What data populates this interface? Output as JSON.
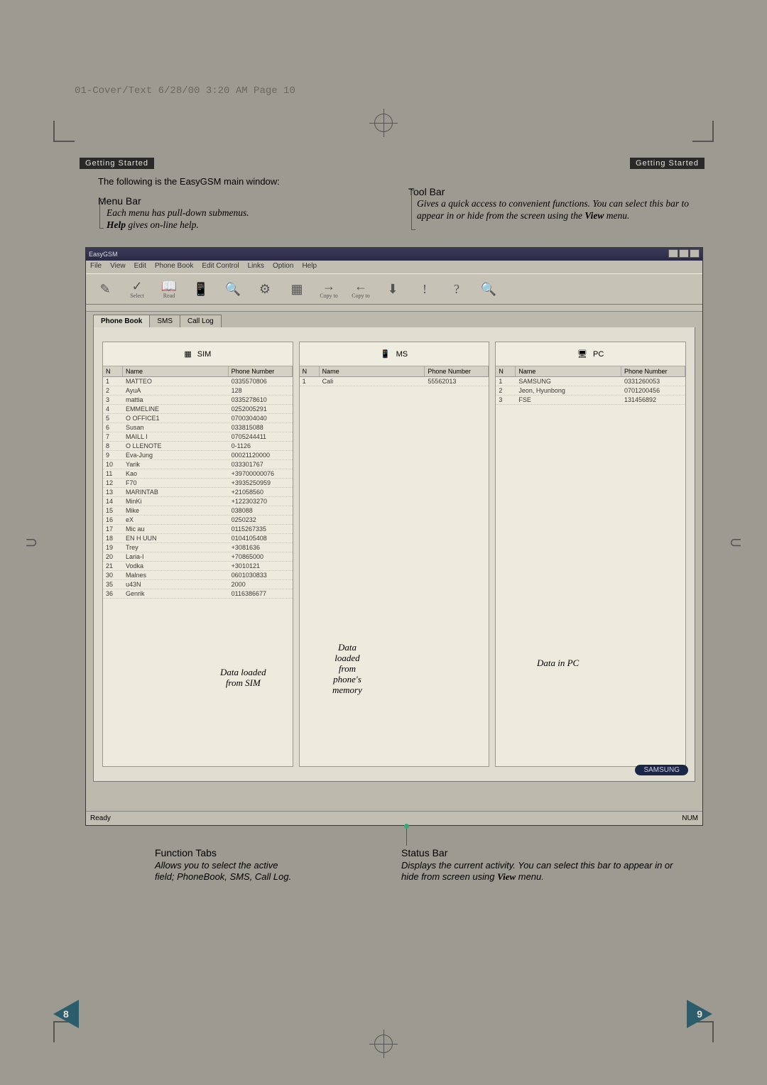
{
  "print_header": "01-Cover/Text  6/28/00  3:20 AM  Page 10",
  "section_label": "Getting Started",
  "intro": "The following is the EasyGSM main window:",
  "menu_bar": {
    "heading": "Menu Bar",
    "line1": "Each menu has pull-down submenus.",
    "line2_bold": "Help",
    "line2_rest": " gives on-line help."
  },
  "tool_bar": {
    "heading": "Tool Bar",
    "text_a": "Gives a quick access to convenient functions. You can select this bar to appear in or hide from the screen using the ",
    "view": "View",
    "text_b": " menu."
  },
  "function_tabs": {
    "heading": "Function Tabs",
    "line1": "Allows you to select the active",
    "line2": "field; PhoneBook, SMS, Call Log."
  },
  "status_bar": {
    "heading": "Status Bar",
    "text_a": "Displays the current activity. You can select this bar to appear in or hide from screen using ",
    "view": "View",
    "text_b": " menu."
  },
  "pages": {
    "left": "8",
    "right": "9"
  },
  "app": {
    "title": "EasyGSM",
    "menus": [
      "File",
      "View",
      "Edit",
      "Phone Book",
      "Edit Control",
      "Links",
      "Option",
      "Help"
    ],
    "toolbar_hints": [
      "",
      "Select",
      "Read",
      "",
      "",
      "",
      "",
      "Copy to",
      "Copy to",
      "",
      "",
      "",
      ""
    ],
    "tabs": [
      "Phone Book",
      "SMS",
      "Call Log"
    ],
    "col_headers": [
      "N",
      "Name",
      "Phone Number"
    ],
    "col_titles": {
      "sim": "SIM",
      "ms": "MS",
      "pc": "PC"
    },
    "captions": {
      "sim": "Data loaded\nfrom SIM",
      "ms": "Data\nloaded\nfrom\nphone's\nmemory",
      "pc": "Data in PC"
    },
    "status_left": "Ready",
    "status_right": "NUM",
    "brand": "SAMSUNG",
    "sim_rows": [
      {
        "n": "1",
        "name": "MATTEO",
        "ph": "0335570806"
      },
      {
        "n": "2",
        "name": "AyuA",
        "ph": "128"
      },
      {
        "n": "3",
        "name": "mattia",
        "ph": "0335278610"
      },
      {
        "n": "4",
        "name": "EMMELINE",
        "ph": "0252005291"
      },
      {
        "n": "5",
        "name": "O OFFICE1",
        "ph": "0700304040"
      },
      {
        "n": "6",
        "name": "Susan",
        "ph": "033815088"
      },
      {
        "n": "7",
        "name": "MAILL I",
        "ph": "0705244411"
      },
      {
        "n": "8",
        "name": "O LLENOTE",
        "ph": "0-1126"
      },
      {
        "n": "9",
        "name": "Eva-Jung",
        "ph": "00021120000"
      },
      {
        "n": "10",
        "name": "Yarik",
        "ph": "033301767"
      },
      {
        "n": "11",
        "name": "Kao",
        "ph": "+39700000076"
      },
      {
        "n": "12",
        "name": "F70",
        "ph": "+3935250959"
      },
      {
        "n": "13",
        "name": "MARINTAB",
        "ph": "+21058560"
      },
      {
        "n": "14",
        "name": "MinKi",
        "ph": "+122303270"
      },
      {
        "n": "15",
        "name": "Mike",
        "ph": "038088"
      },
      {
        "n": "16",
        "name": "eX",
        "ph": "0250232"
      },
      {
        "n": "17",
        "name": "Mic au",
        "ph": "0115267335"
      },
      {
        "n": "18",
        "name": "EN H UUN",
        "ph": "0104105408"
      },
      {
        "n": "19",
        "name": "Trey",
        "ph": "+3081636"
      },
      {
        "n": "20",
        "name": "Laria-I",
        "ph": "+70865000"
      },
      {
        "n": "21",
        "name": "Vodka",
        "ph": "+3010121"
      },
      {
        "n": "30",
        "name": "Malnes",
        "ph": "0601030833"
      },
      {
        "n": "35",
        "name": "u43N",
        "ph": "2000"
      },
      {
        "n": "36",
        "name": "Genrik",
        "ph": "0116386677"
      }
    ],
    "ms_rows": [
      {
        "n": "1",
        "name": "Cali",
        "ph": "55562013"
      }
    ],
    "pc_rows": [
      {
        "n": "1",
        "name": "SAMSUNG",
        "ph": "0331260053"
      },
      {
        "n": "2",
        "name": "Jeon, Hyunbong",
        "ph": "0701200456"
      },
      {
        "n": "3",
        "name": "FSE",
        "ph": "131456892"
      }
    ]
  }
}
